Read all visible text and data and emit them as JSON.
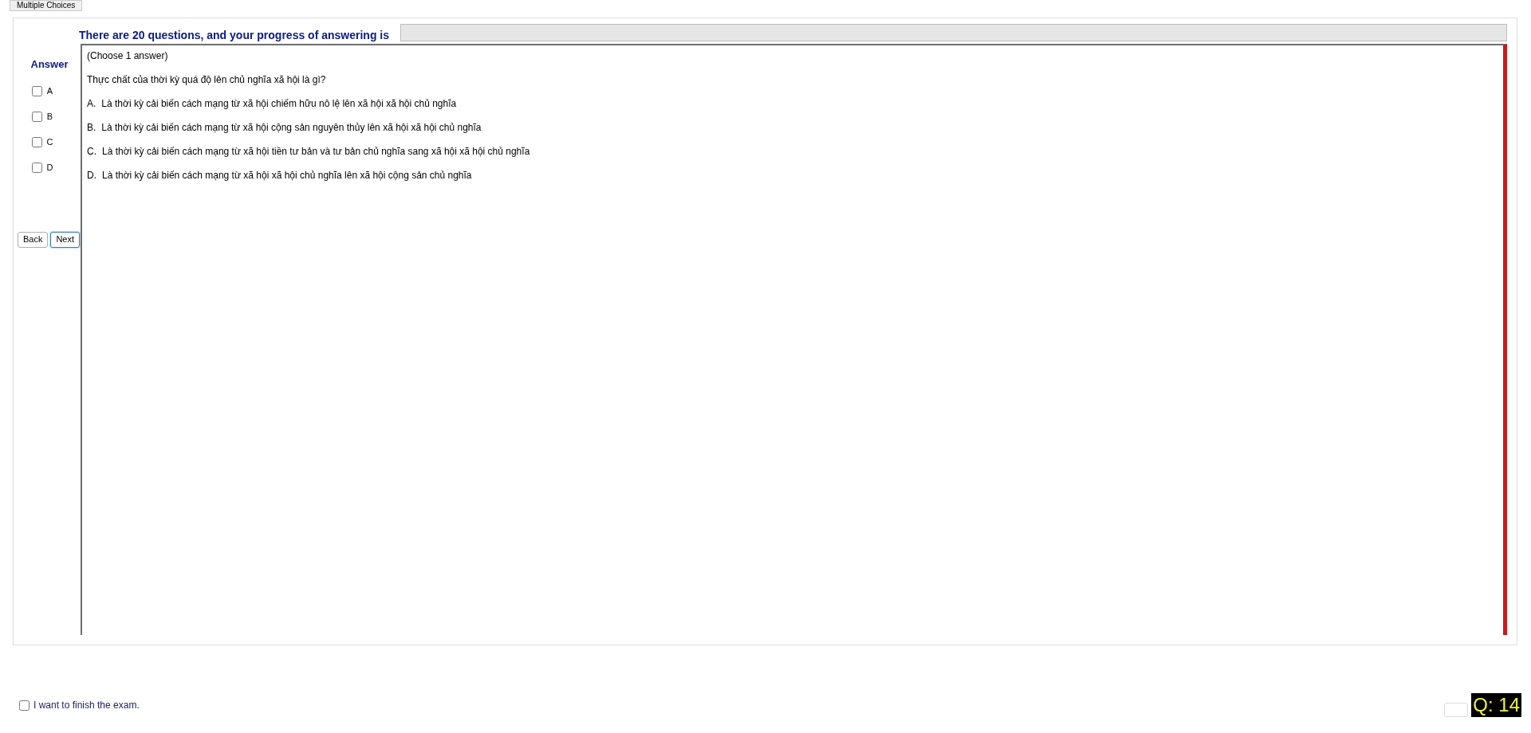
{
  "tab": {
    "label": "Multiple Choices"
  },
  "header": {
    "text": "There are 20 questions, and your progress of answering is"
  },
  "progress": {
    "level": 0
  },
  "answer_panel": {
    "title": "Answer",
    "options": [
      {
        "label": "A",
        "checked": false
      },
      {
        "label": "B",
        "checked": false
      },
      {
        "label": "C",
        "checked": false
      },
      {
        "label": "D",
        "checked": false
      }
    ],
    "buttons": [
      {
        "label": "Back",
        "focused": false
      },
      {
        "label": "Next",
        "focused": true
      }
    ]
  },
  "question": {
    "instruction": "(Choose 1 answer)",
    "text": "Thực chất của thời kỳ quá độ lên chủ nghĩa xã hội là gì?",
    "choices": [
      {
        "letter": "A.",
        "text": "Là thời kỳ cải biến cách mạng từ xã hội chiếm hữu nô lệ lên xã hội xã hội chủ nghĩa"
      },
      {
        "letter": "B.",
        "text": "Là thời kỳ cải biến cách mạng từ xã hội cộng sản nguyên thủy lên xã hội xã hội chủ nghĩa"
      },
      {
        "letter": "C.",
        "text": "Là thời kỳ cải biến cách mạng từ xã hội tiền tư bản và tư bản chủ nghĩa sang xã hội xã hội chủ nghĩa"
      },
      {
        "letter": "D.",
        "text": "Là thời kỳ cải biến cách mạng từ xã hội xã hội chủ nghĩa lên xã hội cộng sản chủ nghĩa"
      }
    ]
  },
  "finish": {
    "label": "I want to finish the exam.",
    "checked": false
  },
  "question_number": "Q: 14"
}
